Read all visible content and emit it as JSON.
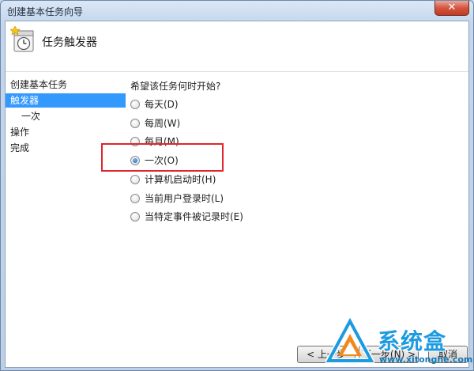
{
  "window": {
    "title": "创建基本任务向导",
    "close_label": "✕"
  },
  "header": {
    "title": "任务触发器"
  },
  "nav": {
    "items": [
      {
        "label": "创建基本任务"
      },
      {
        "label": "触发器"
      },
      {
        "label": "一次"
      },
      {
        "label": "操作"
      },
      {
        "label": "完成"
      }
    ]
  },
  "content": {
    "question": "希望该任务何时开始?",
    "options": [
      {
        "label": "每天(D)",
        "checked": false
      },
      {
        "label": "每周(W)",
        "checked": false
      },
      {
        "label": "每月(M)",
        "checked": false
      },
      {
        "label": "一次(O)",
        "checked": true
      },
      {
        "label": "计算机启动时(H)",
        "checked": false
      },
      {
        "label": "当前用户登录时(L)",
        "checked": false
      },
      {
        "label": "当特定事件被记录时(E)",
        "checked": false
      }
    ]
  },
  "buttons": {
    "back": "< 上一步",
    "next": "下一步(N) >",
    "cancel": "取消"
  },
  "watermark": {
    "brand": "系统盒",
    "url": "www.xitonghe.com"
  },
  "colors": {
    "selection": "#3399ff",
    "highlight": "#e0262b",
    "watermark": "#1d9be0"
  }
}
